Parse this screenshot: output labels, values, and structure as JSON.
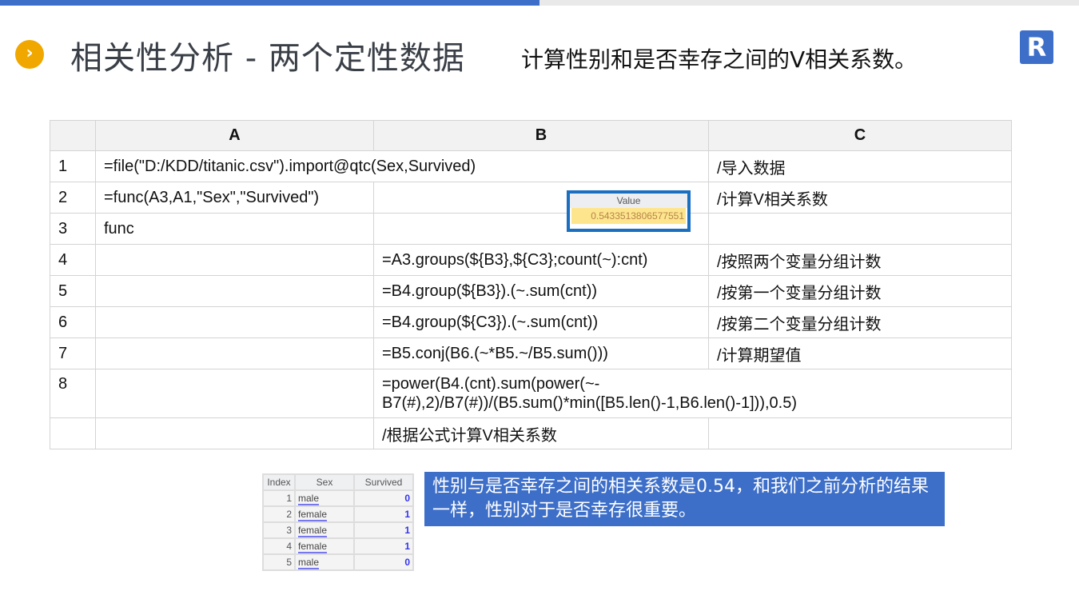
{
  "header": {
    "badge": "›",
    "title": "相关性分析 - 两个定性数据",
    "subtitle": "计算性别和是否幸存之间的V相关系数。",
    "logo": "R"
  },
  "grid": {
    "columns": [
      "A",
      "B",
      "C"
    ],
    "rows": [
      {
        "n": "1",
        "a": "=file(\"D:/KDD/titanic.csv\").import@qtc(Sex,Survived)",
        "c": "/导入数据"
      },
      {
        "n": "2",
        "a": "=func(A3,A1,\"Sex\",\"Survived\")",
        "b": "",
        "c": "/计算V相关系数"
      },
      {
        "n": "3",
        "a": "func",
        "b": "",
        "c": ""
      },
      {
        "n": "4",
        "a": "",
        "b": "=A3.groups(${B3},${C3};count(~):cnt)",
        "c": "/按照两个变量分组计数"
      },
      {
        "n": "5",
        "a": "",
        "b": "=B4.group(${B3}).(~.sum(cnt))",
        "c": "/按第一个变量分组计数"
      },
      {
        "n": "6",
        "a": "",
        "b": "=B4.group(${C3}).(~.sum(cnt))",
        "c": "/按第二个变量分组计数"
      },
      {
        "n": "7",
        "a": "",
        "b": "=B5.conj(B6.(~*B5.~/B5.sum()))",
        "c": "/计算期望值"
      },
      {
        "n": "8",
        "a": "",
        "b": "=power(B4.(cnt).sum(power(~-B7(#),2)/B7(#))/(B5.sum()*min([B5.len()-1,B6.len()-1])),0.5)"
      },
      {
        "n": "",
        "a": "",
        "b": "/根据公式计算V相关系数",
        "c": ""
      }
    ]
  },
  "value_popup": {
    "header": "Value",
    "value": "0.5433513806577551"
  },
  "mini_table": {
    "headers": [
      "Index",
      "Sex",
      "Survived"
    ],
    "rows": [
      [
        "1",
        "male",
        "0"
      ],
      [
        "2",
        "female",
        "1"
      ],
      [
        "3",
        "female",
        "1"
      ],
      [
        "4",
        "female",
        "1"
      ],
      [
        "5",
        "male",
        "0"
      ]
    ]
  },
  "note": "性别与是否幸存之间的相关系数是0.54，和我们之前分析的结果一样，性别对于是否幸存很重要。"
}
